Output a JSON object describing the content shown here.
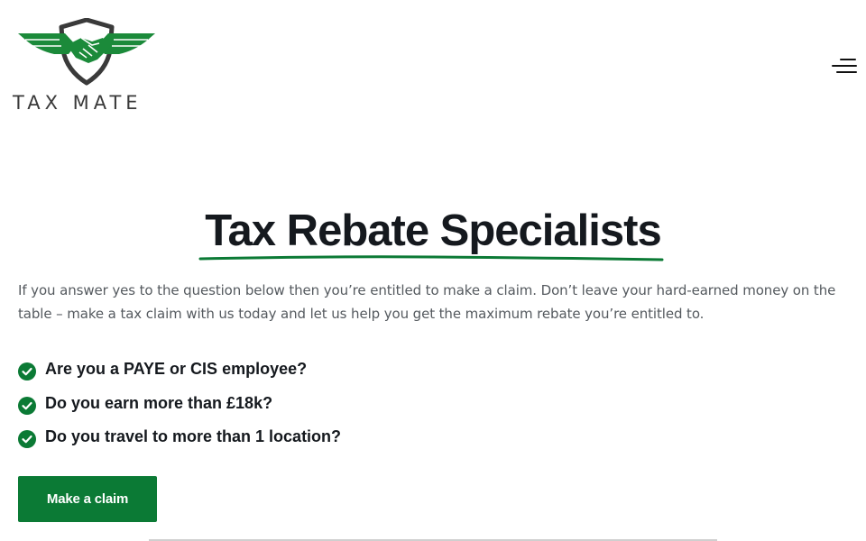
{
  "header": {
    "logo_text": "TAX MATE",
    "menu_icon": "hamburger-menu-icon"
  },
  "hero": {
    "title": "Tax Rebate Specialists",
    "intro": "If you answer yes to the question below then you’re entitled to make a claim. Don’t leave your hard-earned money on the table – make a tax claim with us today and let us help you get the maximum rebate you’re entitled to."
  },
  "checklist": [
    {
      "icon": "check-circle-icon",
      "text": "Are you a PAYE or CIS employee?"
    },
    {
      "icon": "check-circle-icon",
      "text": "Do you earn more than £18k?"
    },
    {
      "icon": "check-circle-icon",
      "text": "Do you travel to more than 1 location?"
    }
  ],
  "cta": {
    "label": "Make a claim"
  },
  "colors": {
    "brand_green": "#0b7a35",
    "logo_green": "#1b8a3a",
    "logo_dark": "#3a3a3a",
    "heading": "#15191e",
    "body_text": "#555a5f"
  }
}
